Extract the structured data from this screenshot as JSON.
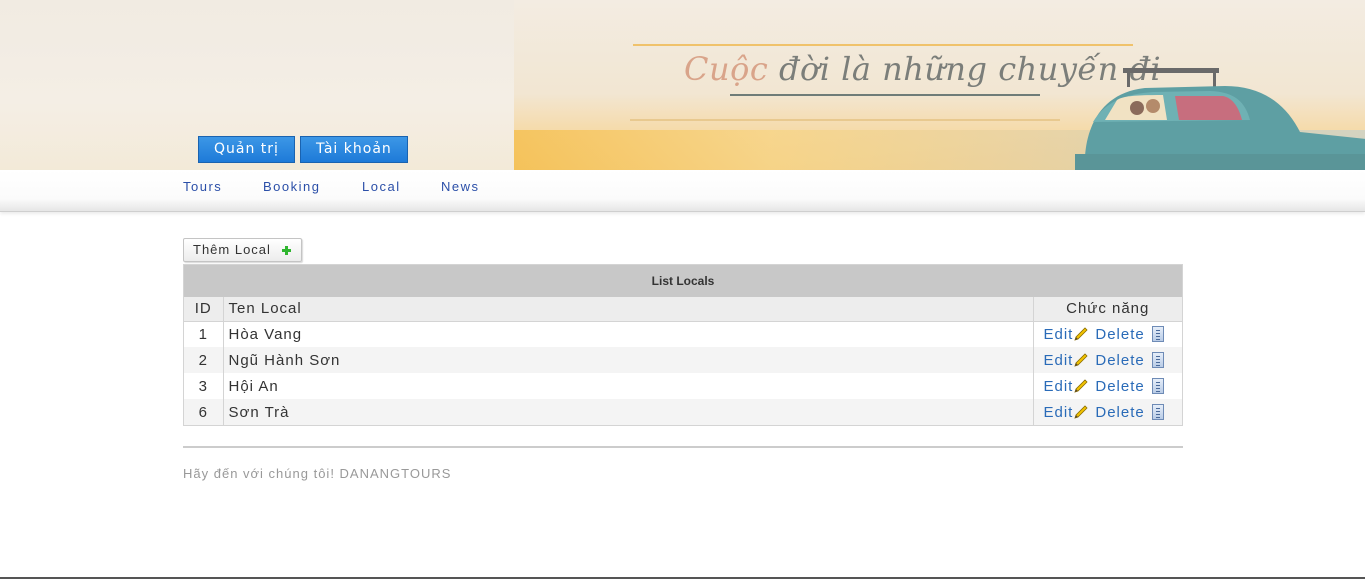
{
  "header": {
    "slogan_first": "Cuộc",
    "slogan_rest": " đời là những chuyến đi",
    "tabs": [
      {
        "label": "Quản trị"
      },
      {
        "label": "Tài khoản"
      }
    ]
  },
  "nav": {
    "items": [
      {
        "label": "Tours"
      },
      {
        "label": "Booking"
      },
      {
        "label": "Local"
      },
      {
        "label": "News"
      }
    ]
  },
  "toolbar": {
    "add_label": "Thêm Local"
  },
  "table": {
    "caption": "List Locals",
    "columns": [
      "ID",
      "Ten Local",
      "Chức năng"
    ],
    "edit_label": "Edit",
    "delete_label": "Delete",
    "rows": [
      {
        "id": "1",
        "name": "Hòa Vang"
      },
      {
        "id": "2",
        "name": "Ngũ Hành Sơn"
      },
      {
        "id": "3",
        "name": "Hội An"
      },
      {
        "id": "6",
        "name": "Sơn Trà"
      }
    ]
  },
  "footer": {
    "text": "Hãy đến với chúng tôi! DANANGTOURS"
  },
  "colors": {
    "tab_blue": "#1e7ad8",
    "link_blue": "#2a6bb8",
    "nav_blue": "#2b4fa8",
    "add_plus_green": "#2fb52f"
  }
}
